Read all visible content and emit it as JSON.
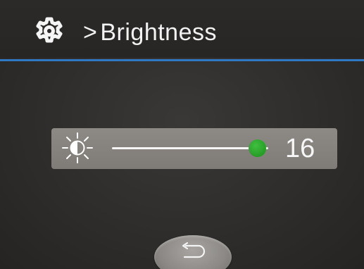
{
  "header": {
    "icon": "gear-icon",
    "separator": ">",
    "title": "Brightness"
  },
  "brightness": {
    "icon": "brightness-sun-icon",
    "value": "16",
    "level_fraction": 0.93
  },
  "footer": {
    "back_icon": "return-arrow-icon"
  },
  "colors": {
    "accent_line": "#2f78c4",
    "slider_knob": "#2aa32a",
    "panel": "#86827e",
    "background": "#2f2d2b"
  }
}
